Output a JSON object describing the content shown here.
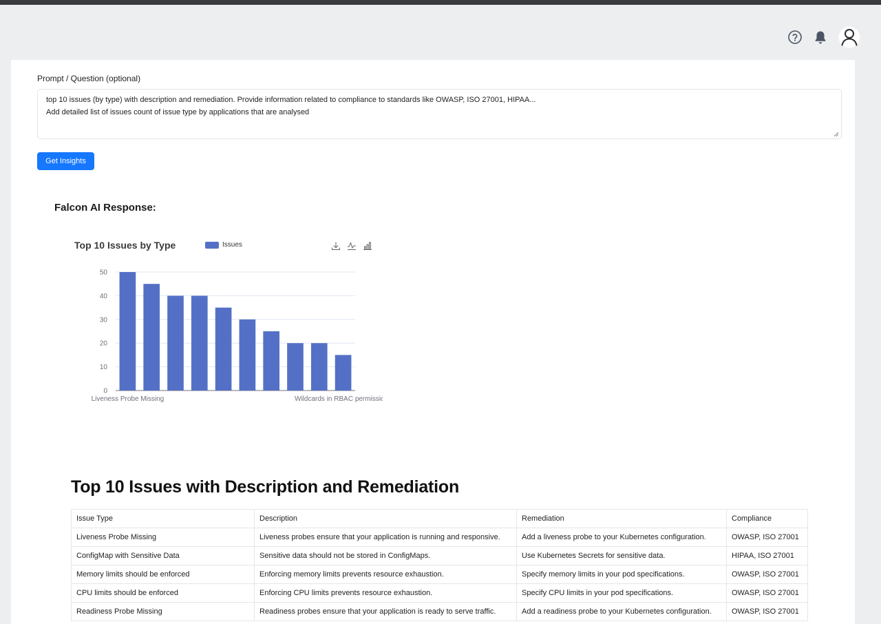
{
  "header": {
    "icons": [
      "help-icon",
      "bell-icon",
      "user-icon"
    ]
  },
  "prompt": {
    "label": "Prompt / Question (optional)",
    "lines": [
      "top 10 issues (by type) with description and remediation. Provide information related to compliance to standards like OWASP, ISO 27001, HIPAA...",
      "",
      "Add detailed list of issues count of issue type by applications that are analysed"
    ],
    "button_label": "Get Insights"
  },
  "response": {
    "title": "Falcon AI Response:"
  },
  "colors": {
    "accent": "#1677ff",
    "bar": "#5470c6"
  },
  "chart_data": {
    "type": "bar",
    "title": "Top 10 Issues by Type",
    "legend": [
      "Issues"
    ],
    "legend_position": "top",
    "categories": [
      "Liveness Probe Missing",
      "ConfigMap with Sensitive Data",
      "Memory limits should be enforced",
      "CPU limits should be enforced",
      "Readiness Probe Missing",
      "",
      "",
      "",
      "",
      "Wildcards in RBAC permissions"
    ],
    "shown_category_labels": [
      "Liveness Probe Missing",
      "Wildcards in RBAC permissions"
    ],
    "series": [
      {
        "name": "Issues",
        "values": [
          50,
          45,
          40,
          40,
          35,
          30,
          25,
          20,
          20,
          15
        ]
      }
    ],
    "ylim": [
      0,
      50
    ],
    "yticks": [
      0,
      10,
      20,
      30,
      40,
      50
    ],
    "grid": true,
    "toolbox": [
      "download-icon",
      "line-chart-icon",
      "bar-chart-icon"
    ]
  },
  "section": {
    "title": "Top 10 Issues with Description and Remediation"
  },
  "table": {
    "headers": [
      "Issue Type",
      "Description",
      "Remediation",
      "Compliance"
    ],
    "rows": [
      [
        "Liveness Probe Missing",
        "Liveness probes ensure that your application is running and responsive.",
        "Add a liveness probe to your Kubernetes configuration.",
        "OWASP, ISO 27001"
      ],
      [
        "ConfigMap with Sensitive Data",
        "Sensitive data should not be stored in ConfigMaps.",
        "Use Kubernetes Secrets for sensitive data.",
        "HIPAA, ISO 27001"
      ],
      [
        "Memory limits should be enforced",
        "Enforcing memory limits prevents resource exhaustion.",
        "Specify memory limits in your pod specifications.",
        "OWASP, ISO 27001"
      ],
      [
        "CPU limits should be enforced",
        "Enforcing CPU limits prevents resource exhaustion.",
        "Specify CPU limits in your pod specifications.",
        "OWASP, ISO 27001"
      ],
      [
        "Readiness Probe Missing",
        "Readiness probes ensure that your application is ready to serve traffic.",
        "Add a readiness probe to your Kubernetes configuration.",
        "OWASP, ISO 27001"
      ]
    ]
  }
}
